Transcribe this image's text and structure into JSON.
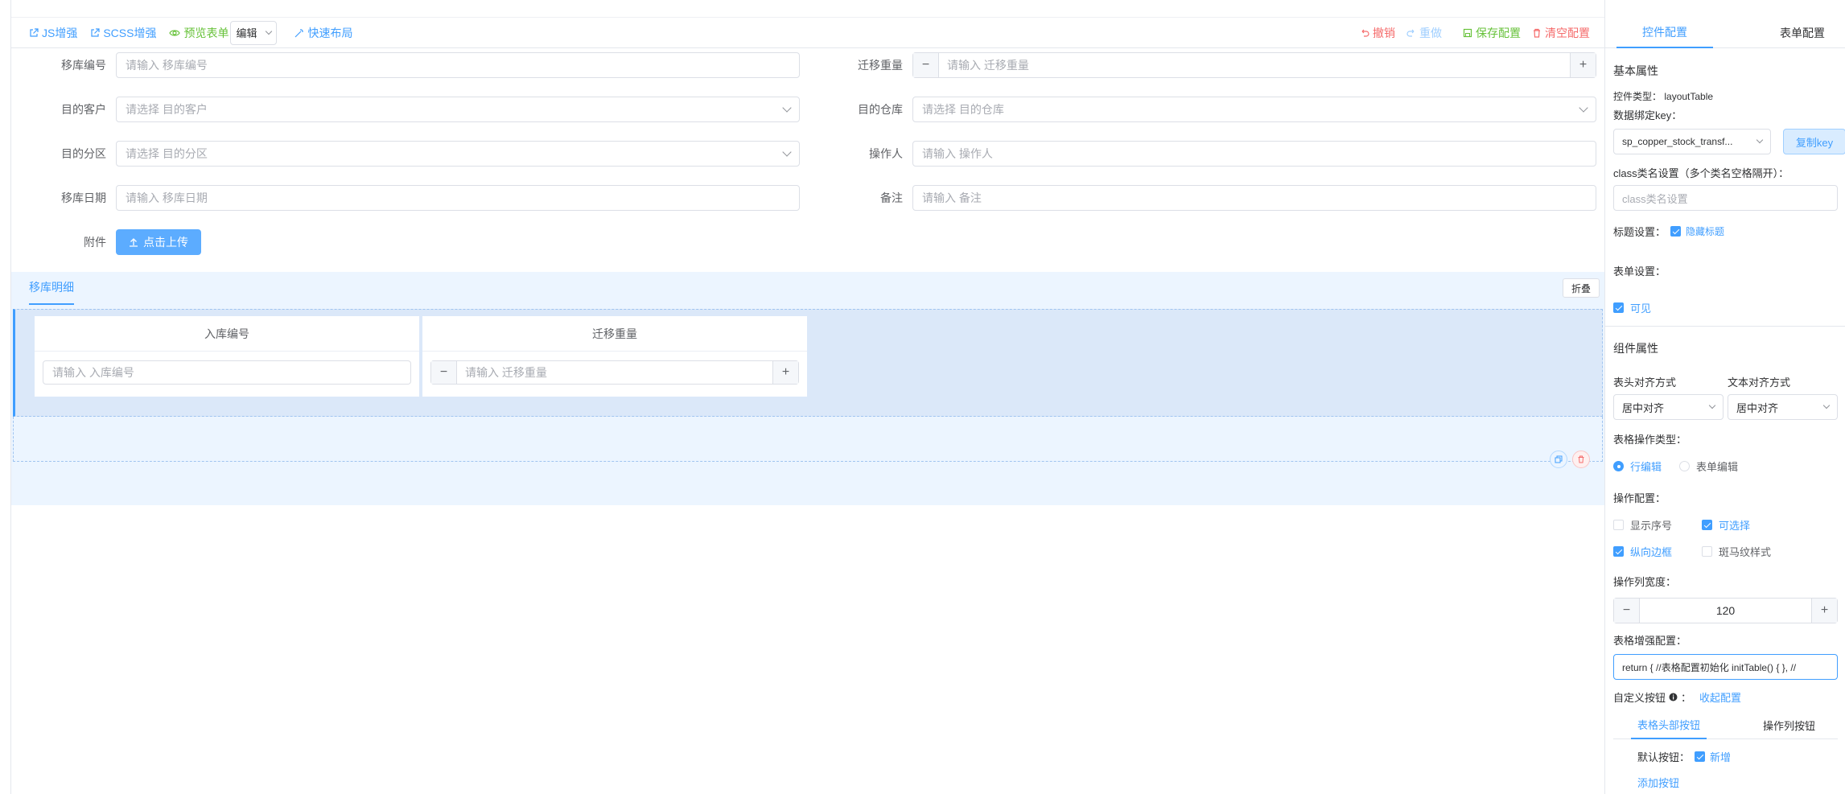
{
  "toolbar": {
    "js": "JS增强",
    "scss": "SCSS增强",
    "preview": "预览表单",
    "mode_select": "编辑",
    "quick_layout": "快速布局",
    "undo": "撤销",
    "redo": "重做",
    "save": "保存配置",
    "clear": "清空配置"
  },
  "form": {
    "transfer_no": {
      "label": "移库编号",
      "placeholder": "请输入 移库编号"
    },
    "weight": {
      "label": "迁移重量",
      "placeholder": "请输入 迁移重量"
    },
    "customer": {
      "label": "目的客户",
      "placeholder": "请选择 目的客户"
    },
    "warehouse": {
      "label": "目的仓库",
      "placeholder": "请选择 目的仓库"
    },
    "zone": {
      "label": "目的分区",
      "placeholder": "请选择 目的分区"
    },
    "operator": {
      "label": "操作人",
      "placeholder": "请输入 操作人"
    },
    "date": {
      "label": "移库日期",
      "placeholder": "请输入 移库日期"
    },
    "remark": {
      "label": "备注",
      "placeholder": "请输入 备注"
    },
    "attachment": {
      "label": "附件",
      "button": "点击上传"
    }
  },
  "subtable": {
    "tab": "移库明细",
    "collapse": "折叠",
    "columns": [
      {
        "header": "入库编号",
        "placeholder": "请输入 入库编号"
      },
      {
        "header": "迁移重量",
        "placeholder": "请输入 迁移重量"
      }
    ]
  },
  "panel": {
    "tabs": [
      "控件配置",
      "表单配置"
    ],
    "basic_title": "基本属性",
    "control_type_label": "控件类型：",
    "control_type_value": "layoutTable",
    "data_key_label": "数据绑定key：",
    "data_key_value": "sp_copper_stock_transf...",
    "copy_key": "复制key",
    "class_label": "class类名设置（多个类名空格隔开）：",
    "class_placeholder": "class类名设置",
    "title_setting_label": "标题设置：",
    "hide_title": "隐藏标题",
    "form_setting_label": "表单设置：",
    "visible": "可见",
    "component_title": "组件属性",
    "header_align_label": "表头对齐方式",
    "text_align_label": "文本对齐方式",
    "header_align_value": "居中对齐",
    "text_align_value": "居中对齐",
    "op_type_label": "表格操作类型：",
    "op_type_options": [
      "行编辑",
      "表单编辑"
    ],
    "op_config_label": "操作配置：",
    "op_config_options": [
      "显示序号",
      "可选择",
      "纵向边框",
      "斑马纹样式"
    ],
    "op_width_label": "操作列宽度：",
    "op_width_value": "120",
    "enhance_label": "表格增强配置：",
    "enhance_value": "return {  //表格配置初始化  initTable() {      },  //",
    "custom_btn_label": "自定义按钮",
    "collapse_config": "收起配置",
    "btn_tabs": [
      "表格头部按钮",
      "操作列按钮"
    ],
    "default_btn_label": "默认按钮：",
    "default_btn_value": "新增",
    "add_btn": "添加按钮"
  }
}
